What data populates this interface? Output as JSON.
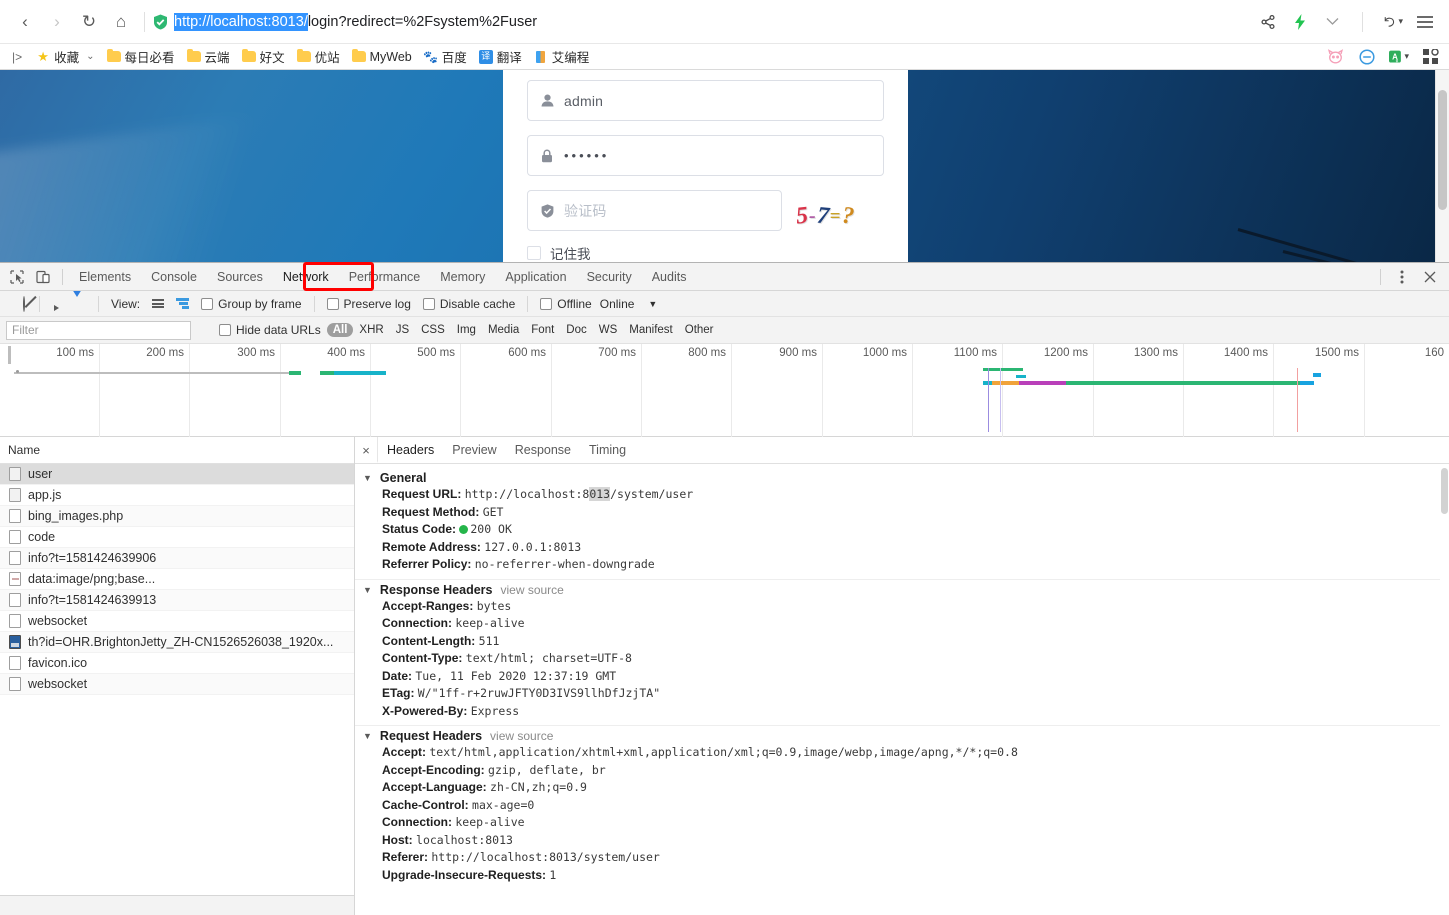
{
  "browser": {
    "nav": {
      "back": "‹",
      "forward": "›",
      "reload": "↻",
      "home": "⌂"
    },
    "url": {
      "scheme_host": "http://localhost:8013/",
      "rest": "login?redirect=%2Fsystem%2Fuser"
    },
    "right_icons": [
      "share-icon",
      "lightning-icon",
      "chevron-down-icon",
      "history-back-icon",
      "menu-icon"
    ],
    "bookmarks": [
      {
        "label": "收藏",
        "icon": "star-icon",
        "has_caret": true
      },
      {
        "label": "每日必看",
        "icon": "folder-icon"
      },
      {
        "label": "云端",
        "icon": "folder-icon"
      },
      {
        "label": "好文",
        "icon": "folder-icon"
      },
      {
        "label": "优站",
        "icon": "folder-icon"
      },
      {
        "label": "MyWeb",
        "icon": "folder-icon"
      },
      {
        "label": "百度",
        "icon": "baidu-icon"
      },
      {
        "label": "翻译",
        "icon": "translate-icon"
      },
      {
        "label": "艾编程",
        "icon": "bar-icon"
      }
    ],
    "bookmarks_right_icons": [
      "cat-icon",
      "block-icon",
      "translate-ext-icon",
      "extensions-grid-icon"
    ]
  },
  "login_page": {
    "username": {
      "value": "admin",
      "icon": "user-icon"
    },
    "password": {
      "value": "••••••",
      "icon": "lock-icon"
    },
    "captcha_input": {
      "placeholder": "验证码",
      "icon": "shield-icon"
    },
    "captcha_image": {
      "text": "5-7=?",
      "chars": [
        "5",
        "-",
        "7",
        "=",
        "?"
      ],
      "colors": [
        "#d9344a",
        "#b05fa8",
        "#1f3f7a",
        "#c9a227",
        "#d08a1e"
      ]
    },
    "remember": {
      "label": "记住我",
      "checked": false
    }
  },
  "devtools": {
    "tool_icons": [
      "inspect-element-icon",
      "device-toolbar-icon"
    ],
    "tabs": [
      {
        "label": "Elements",
        "selected": false
      },
      {
        "label": "Console",
        "selected": false
      },
      {
        "label": "Sources",
        "selected": false
      },
      {
        "label": "Network",
        "selected": true,
        "annotated": true
      },
      {
        "label": "Performance",
        "selected": false
      },
      {
        "label": "Memory",
        "selected": false
      },
      {
        "label": "Application",
        "selected": false
      },
      {
        "label": "Security",
        "selected": false
      },
      {
        "label": "Audits",
        "selected": false
      }
    ],
    "tabbar_right": [
      "more-options-icon",
      "close-devtools-icon"
    ],
    "annotation_color": "#ff0000",
    "toolbar": {
      "record_label": "record-button",
      "clear_label": "clear-button",
      "screenshot_label": "capture-screenshots-button",
      "filter_label": "filter-button",
      "view_label": "View:",
      "group_by_frame": "Group by frame",
      "preserve_log": "Preserve log",
      "disable_cache": "Disable cache",
      "offline": "Offline",
      "throttle": "Online",
      "throttle_caret": "▼"
    },
    "filterbar": {
      "filter_placeholder": "Filter",
      "hide_data_urls": "Hide data URLs",
      "types": [
        "All",
        "XHR",
        "JS",
        "CSS",
        "Img",
        "Media",
        "Font",
        "Doc",
        "WS",
        "Manifest",
        "Other"
      ],
      "active_type": "All"
    },
    "overview": {
      "ticks": [
        "100 ms",
        "200 ms",
        "300 ms",
        "400 ms",
        "500 ms",
        "600 ms",
        "700 ms",
        "800 ms",
        "900 ms",
        "1000 ms",
        "1100 ms",
        "1200 ms",
        "1300 ms",
        "1400 ms",
        "1500 ms",
        "160"
      ]
    },
    "requests": {
      "column_header": "Name",
      "rows": [
        {
          "name": "user",
          "icon": "document-icon",
          "selected": true
        },
        {
          "name": "app.js",
          "icon": "script-icon",
          "selected": false
        },
        {
          "name": "bing_images.php",
          "icon": "document-icon",
          "selected": false
        },
        {
          "name": "code",
          "icon": "document-icon",
          "selected": false
        },
        {
          "name": "info?t=1581424639906",
          "icon": "document-icon",
          "selected": false
        },
        {
          "name": "data:image/png;base...",
          "icon": "data-url-icon",
          "selected": false
        },
        {
          "name": "info?t=1581424639913",
          "icon": "document-icon",
          "selected": false
        },
        {
          "name": "websocket",
          "icon": "document-icon",
          "selected": false
        },
        {
          "name": "th?id=OHR.BrightonJetty_ZH-CN1526526038_1920x...",
          "icon": "image-icon",
          "selected": false
        },
        {
          "name": "favicon.ico",
          "icon": "document-icon",
          "selected": false
        },
        {
          "name": "websocket",
          "icon": "document-icon",
          "selected": false
        }
      ]
    },
    "detail": {
      "tabs": [
        {
          "label": "Headers",
          "selected": true
        },
        {
          "label": "Preview",
          "selected": false
        },
        {
          "label": "Response",
          "selected": false
        },
        {
          "label": "Timing",
          "selected": false
        }
      ],
      "close_label": "×",
      "view_source": "view source",
      "groups": [
        {
          "title": "General",
          "view_source": false,
          "rows": [
            {
              "key": "Request URL:",
              "value_pre": "http://localhost:8",
              "value_hl": "013",
              "value_post": "/system/user"
            },
            {
              "key": "Request Method:",
              "value": "GET"
            },
            {
              "key": "Status Code:",
              "value": "200 OK",
              "status_dot": true
            },
            {
              "key": "Remote Address:",
              "value": "127.0.0.1:8013"
            },
            {
              "key": "Referrer Policy:",
              "value": "no-referrer-when-downgrade"
            }
          ]
        },
        {
          "title": "Response Headers",
          "view_source": true,
          "rows": [
            {
              "key": "Accept-Ranges:",
              "value": "bytes"
            },
            {
              "key": "Connection:",
              "value": "keep-alive"
            },
            {
              "key": "Content-Length:",
              "value": "511"
            },
            {
              "key": "Content-Type:",
              "value": "text/html; charset=UTF-8"
            },
            {
              "key": "Date:",
              "value": "Tue, 11 Feb 2020 12:37:19 GMT"
            },
            {
              "key": "ETag:",
              "value": "W/\"1ff-r+2ruwJFTY0D3IVS9llhDfJzjTA\""
            },
            {
              "key": "X-Powered-By:",
              "value": "Express"
            }
          ]
        },
        {
          "title": "Request Headers",
          "view_source": true,
          "rows": [
            {
              "key": "Accept:",
              "value": "text/html,application/xhtml+xml,application/xml;q=0.9,image/webp,image/apng,*/*;q=0.8"
            },
            {
              "key": "Accept-Encoding:",
              "value": "gzip, deflate, br"
            },
            {
              "key": "Accept-Language:",
              "value": "zh-CN,zh;q=0.9"
            },
            {
              "key": "Cache-Control:",
              "value": "max-age=0"
            },
            {
              "key": "Connection:",
              "value": "keep-alive"
            },
            {
              "key": "Host:",
              "value": "localhost:8013"
            },
            {
              "key": "Referer:",
              "value": "http://localhost:8013/system/user"
            },
            {
              "key": "Upgrade-Insecure-Requests:",
              "value": "1"
            }
          ]
        }
      ]
    }
  }
}
